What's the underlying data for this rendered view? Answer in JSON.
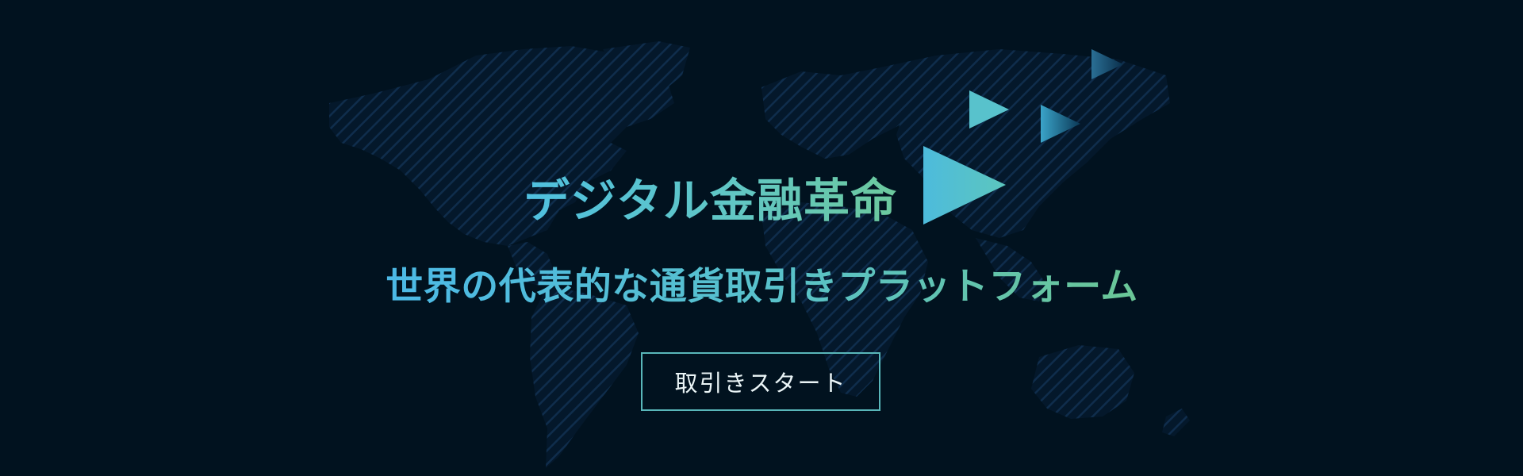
{
  "banner": {
    "headline": "デジタル金融革命",
    "subheadline": "世界の代表的な通貨取引きプラットフォーム",
    "cta_label": "取引きスタート"
  },
  "decorations": {
    "background_map": "world-map-hatched",
    "icons": [
      "play-triangle-icon",
      "arrow-triangle-icon"
    ]
  },
  "colors": {
    "background": "#01121f",
    "map_hatch": "#0d2a47",
    "accent_blue": "#4fc0e0",
    "accent_green": "#6cc99d",
    "button_border": "#59b7ba"
  }
}
